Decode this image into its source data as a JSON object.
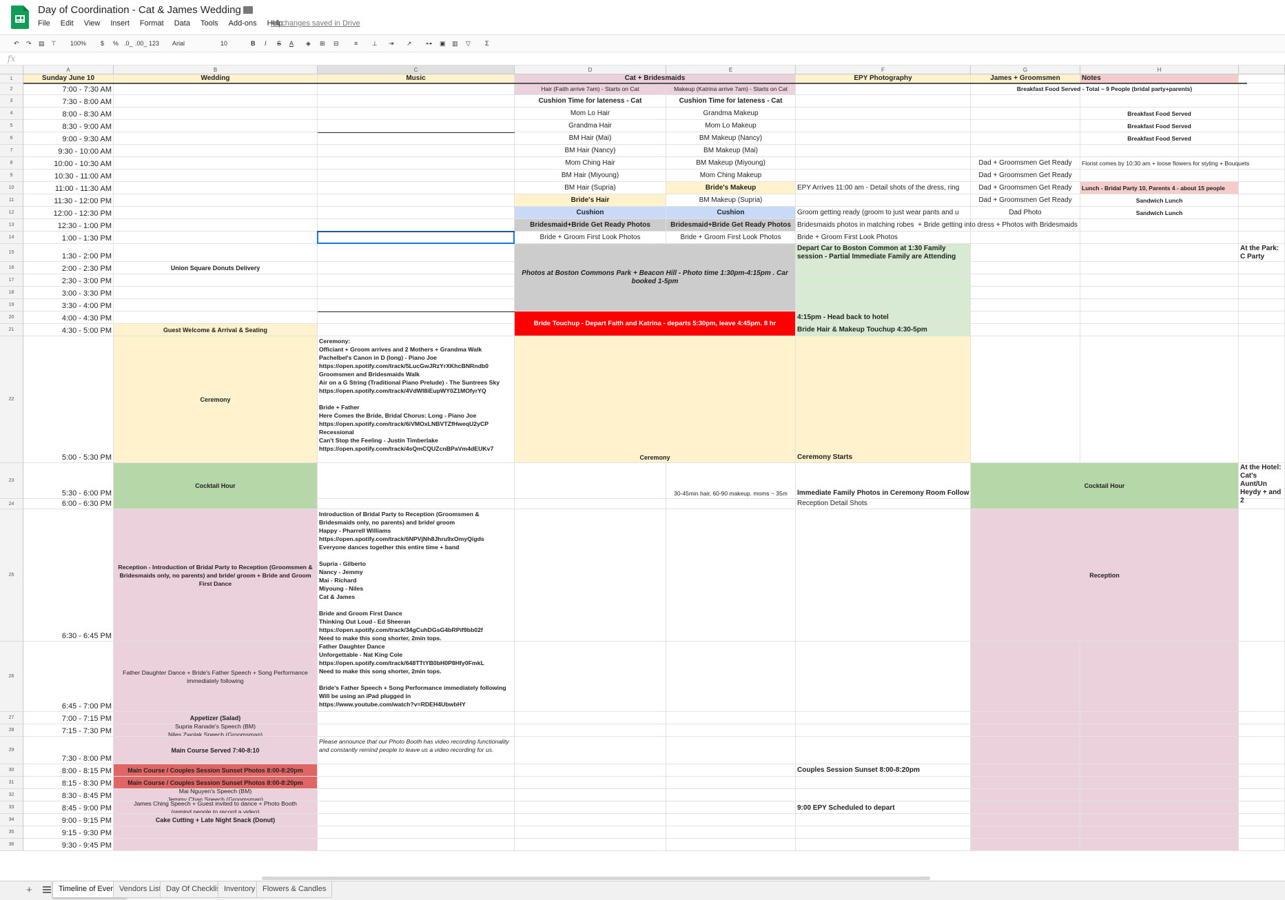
{
  "doc": {
    "title": "Day of Coordination - Cat & James Wedding",
    "saved": "All changes saved in Drive"
  },
  "menu": [
    "File",
    "Edit",
    "View",
    "Insert",
    "Format",
    "Data",
    "Tools",
    "Add-ons",
    "Help"
  ],
  "toolbar": {
    "zoom": "100%",
    "currency": "$",
    "percent": "%",
    "dec_less": ".0_",
    "dec_more": ".00_",
    "format": "123",
    "font": "Arial",
    "size": "10"
  },
  "formula_bar": {
    "fx": "fx",
    "value": ""
  },
  "columns": [
    "A",
    "B",
    "C",
    "D",
    "E",
    "F",
    "G",
    "H"
  ],
  "sheet_tabs": [
    "Timeline of Events",
    "Vendors List",
    "Day Of Checklist",
    "Inventory",
    "Flowers & Candles"
  ],
  "active_tab": "Timeline of Events",
  "colors": {
    "header_yellow": "#fff2cc",
    "pink": "#ead1dc",
    "green": "#d9ead3",
    "green_dark": "#b6d7a8",
    "gray": "#cccccc",
    "blue": "#c9daf8",
    "red": "#ff0000",
    "salmon": "#e06666",
    "light_pink": "#f4cccc",
    "grid": "#e2e2e2",
    "selection": "#1a73e8"
  },
  "row_labels": [
    "1",
    "2",
    "3",
    "4",
    "5",
    "6",
    "7",
    "8",
    "9",
    "10",
    "11",
    "12",
    "13",
    "14",
    "15",
    "16",
    "17",
    "18",
    "19",
    "20",
    "21",
    "22",
    "23",
    "24",
    "25",
    "26",
    "27",
    "28",
    "29",
    "30",
    "31",
    "32",
    "33",
    "34",
    "35",
    "36"
  ],
  "cells": [
    {
      "id": "A1",
      "v": "Sunday June 10"
    },
    {
      "id": "B1",
      "v": "Wedding"
    },
    {
      "id": "C1",
      "v": "Music"
    },
    {
      "id": "D1",
      "v": "Cat + Bridesmaids"
    },
    {
      "id": "F1",
      "v": "EPY Photography"
    },
    {
      "id": "G1",
      "v": "James + Groomsmen"
    },
    {
      "id": "H1",
      "v": "Notes"
    },
    {
      "id": "A2",
      "v": "7:00 - 7:30 AM"
    },
    {
      "id": "A3",
      "v": "7:30 - 8:00 AM"
    },
    {
      "id": "A4",
      "v": "8:00 - 8:30 AM"
    },
    {
      "id": "A5",
      "v": "8:30 - 9:00 AM"
    },
    {
      "id": "A6",
      "v": "9:00 - 9:30 AM"
    },
    {
      "id": "A7",
      "v": "9:30 - 10:00 AM"
    },
    {
      "id": "A8",
      "v": "10:00 - 10:30 AM"
    },
    {
      "id": "A9",
      "v": "10:30 - 11:00 AM"
    },
    {
      "id": "A10",
      "v": "11:00 - 11:30 AM"
    },
    {
      "id": "A11",
      "v": "11:30 - 12:00 PM"
    },
    {
      "id": "A12",
      "v": "12:00 - 12:30 PM"
    },
    {
      "id": "A13",
      "v": "12:30 - 1:00 PM"
    },
    {
      "id": "A14",
      "v": "1:00 - 1:30 PM"
    },
    {
      "id": "A15",
      "v": "1:30 - 2:00 PM"
    },
    {
      "id": "A16",
      "v": "2:00 - 2:30 PM"
    },
    {
      "id": "A17",
      "v": "2:30 - 3:00 PM"
    },
    {
      "id": "A18",
      "v": "3:00 - 3:30 PM"
    },
    {
      "id": "A19",
      "v": "3:30 - 4:00 PM"
    },
    {
      "id": "A20",
      "v": "4:00 - 4:30 PM"
    },
    {
      "id": "A21",
      "v": "4:30 - 5:00 PM"
    },
    {
      "id": "A22",
      "v": "5:00 - 5:30 PM"
    },
    {
      "id": "A23",
      "v": "5:30 - 6:00 PM"
    },
    {
      "id": "A24",
      "v": "6:00 - 6:30 PM"
    },
    {
      "id": "A25",
      "v": "6:30 - 6:45 PM"
    },
    {
      "id": "A26",
      "v": "6:45 - 7:00 PM"
    },
    {
      "id": "A27",
      "v": "7:00 - 7:15 PM"
    },
    {
      "id": "A28",
      "v": "7:15 - 7:30 PM"
    },
    {
      "id": "A29",
      "v": "7:30 - 8:00 PM"
    },
    {
      "id": "A30",
      "v": "8:00 - 8:15 PM"
    },
    {
      "id": "A31",
      "v": "8:15 - 8:30 PM"
    },
    {
      "id": "A32",
      "v": "8:30 - 8:45 PM"
    },
    {
      "id": "A33",
      "v": "8:45 - 9:00 PM"
    },
    {
      "id": "A34",
      "v": "9:00 - 9:15 PM"
    },
    {
      "id": "A35",
      "v": "9:15 - 9:30 PM"
    },
    {
      "id": "A36",
      "v": "9:30 - 9:45 PM"
    },
    {
      "id": "D2",
      "v": "Hair (Faith arrive 7am) - Starts on Cat"
    },
    {
      "id": "E2",
      "v": "Makeup (Katrina arrive 7am) - Starts on Cat"
    },
    {
      "id": "G2",
      "v": "Breakfast Food Served - Total ~ 9 People (bridal party+parents)"
    },
    {
      "id": "D3",
      "v": "Cushion Time for lateness - Cat"
    },
    {
      "id": "E3",
      "v": "Cushion Time for lateness - Cat"
    },
    {
      "id": "D4",
      "v": "Mom Lo Hair"
    },
    {
      "id": "E4",
      "v": "Grandma Makeup"
    },
    {
      "id": "H4",
      "v": "Breakfast Food Served"
    },
    {
      "id": "D5",
      "v": "Grandma Hair"
    },
    {
      "id": "E5",
      "v": "Mom Lo Makeup"
    },
    {
      "id": "H5",
      "v": "Breakfast Food Served"
    },
    {
      "id": "D6",
      "v": "BM Hair (Mai)"
    },
    {
      "id": "E6",
      "v": "BM Makeup (Nancy)"
    },
    {
      "id": "H6",
      "v": "Breakfast Food Served"
    },
    {
      "id": "D7",
      "v": "BM Hair (Nancy)"
    },
    {
      "id": "E7",
      "v": "BM Makeup (Mai)"
    },
    {
      "id": "D8",
      "v": "Mom Ching Hair"
    },
    {
      "id": "E8",
      "v": "BM Makeup (Miyoung)"
    },
    {
      "id": "G8",
      "v": "Dad + Groomsmen Get Ready"
    },
    {
      "id": "H8",
      "v": "Florist comes by 10:30 am + loose flowers for styling + Bouquets"
    },
    {
      "id": "D9",
      "v": "BM Hair (Miyoung)"
    },
    {
      "id": "E9",
      "v": "Mom Ching Makeup"
    },
    {
      "id": "G9",
      "v": "Dad + Groomsmen Get Ready"
    },
    {
      "id": "D10",
      "v": "BM Hair (Supria)"
    },
    {
      "id": "E10",
      "v": "Bride's Makeup"
    },
    {
      "id": "F10",
      "v": "EPY Arrives 11:00 am - Detail shots of the dress, ring"
    },
    {
      "id": "G10",
      "v": "Dad + Groomsmen Get Ready"
    },
    {
      "id": "H10",
      "v": "Lunch - Bridal Party 10, Parents 4 - about 15 people"
    },
    {
      "id": "D11",
      "v": "Bride's Hair"
    },
    {
      "id": "E11",
      "v": "BM Makeup (Supria)"
    },
    {
      "id": "G11",
      "v": "Dad + Groomsmen Get Ready"
    },
    {
      "id": "H11",
      "v": "Sandwich Lunch"
    },
    {
      "id": "D12",
      "v": "Cushion"
    },
    {
      "id": "E12",
      "v": "Cushion"
    },
    {
      "id": "F12",
      "v": "Groom getting ready (groom to just wear pants and u"
    },
    {
      "id": "G12",
      "v": "Dad Photo"
    },
    {
      "id": "H12",
      "v": "Sandwich Lunch"
    },
    {
      "id": "D13",
      "v": "Bridesmaid+Bride Get Ready Photos"
    },
    {
      "id": "E13",
      "v": "Bridesmaid+Bride Get Ready Photos"
    },
    {
      "id": "F13",
      "v": "Bridesmaids photos in matching robes  + Bride getting into dress + Photos with Bridesmaids"
    },
    {
      "id": "D14",
      "v": "Bride + Groom First Look Photos"
    },
    {
      "id": "E14",
      "v": "Bride + Groom First Look Photos"
    },
    {
      "id": "F14",
      "v": "Bride + Groom First Look Photos"
    },
    {
      "id": "F15",
      "v": "Depart Car to Boston Common at 1:30 Family session - Partial Immediate Family are Attending"
    },
    {
      "id": "I15",
      "v": "At the Park: C Party"
    },
    {
      "id": "D15",
      "v": "Photos at Boston Commons Park + Beacon Hill - Photo time 1:30pm-4:15pm .  Car booked 1-5pm"
    },
    {
      "id": "B16",
      "v": "Union Square Donuts Delivery"
    },
    {
      "id": "D20",
      "v": "Bride Touchup - Depart Faith and Katrina - departs 5:30pm, leave 4:45pm. 8 hr"
    },
    {
      "id": "F20",
      "v": "4:15pm - Head back to hotel"
    },
    {
      "id": "B21",
      "v": "Guest Welcome & Arrival & Seating"
    },
    {
      "id": "F21",
      "v": "Bride Hair & Makeup Touchup 4:30-5pm"
    },
    {
      "id": "B22",
      "v": "Ceremony"
    },
    {
      "id": "D22",
      "v": "Ceremony"
    },
    {
      "id": "F22",
      "v": "Ceremony Starts"
    },
    {
      "id": "C22",
      "v": "Ceremony:\nOfficiant + Groom arrives and 2 Mothers + Grandma Walk\nPachelbel's Canon in D (long) - Piano Joe\nhttps://open.spotify.com/track/5LucGwJRzYrXKhcBNRndb0\nGroomsmen and Bridesmaids Walk\nAir on a G String (Traditional Piano Prelude) - The Suntrees Sky\nhttps://open.spotify.com/track/4VdWl8iEupWY0Z1MOfyrYQ\n\nBride + Father\nHere Comes the Bride, Bridal Chorus: Long - Piano Joe\nhttps://open.spotify.com/track/6iVMOxLNBVTZfHweqU2yCP\nRecessional\nCan't Stop the Feeling - Justin Timberlake\nhttps://open.spotify.com/track/4sQmCQUZcnBPaVm4dEUKv7"
    },
    {
      "id": "B23",
      "v": "Cocktail Hour"
    },
    {
      "id": "G23",
      "v": "Cocktail Hour"
    },
    {
      "id": "I23",
      "v": "At the Hotel: Cat's Aunt/Un Heydy + and 2"
    },
    {
      "id": "E24",
      "v": "30-45min hair, 60-90 makeup. moms ~ 35m"
    },
    {
      "id": "F24a",
      "v": "Immediate Family Photos in Ceremony Room Follow"
    },
    {
      "id": "F24",
      "v": "Reception Detail Shots"
    },
    {
      "id": "B25",
      "v": "Reception - Introduction of Bridal Party to Reception (Groomsmen & Bridesmaids only, no parents) and bride/ groom + Bride and Groom First Dance"
    },
    {
      "id": "G25",
      "v": "Reception"
    },
    {
      "id": "C25",
      "v": "Introduction of Bridal Party to Reception (Groomsmen & Bridesmaids only, no parents) and bride/ groom\nHappy - Pharrell Williams\nhttps://open.spotify.com/track/6NPVjNh8Jhru9xOmyQigds\nEveryone dances together this entire time + band\n\nSupria - Gilberto\nNancy - Jemmy\nMai - Richard\nMiyoung - Niles\nCat & James\n\nBride and Groom First Dance\nThinking Out Loud - Ed Sheeran\nhttps://open.spotify.com/track/34gCuhDGsG4bRPif9bb02f\nNeed to make this song shorter, 2min tops."
    },
    {
      "id": "B26",
      "v": "Father Daughter Dance + Bride's Father Speech + Song Performance immediately following"
    },
    {
      "id": "C26",
      "v": "Father Daughter Dance\nUnforgettable - Nat King Cole\nhttps://open.spotify.com/track/648TTtYB0bH0P8Hfy0FmkL\nNeed to make this song shorter, 2min tops.\n\nBride's Father Speech + Song Performance immediately following\nWill be using an iPad plugged in\nhttps://www.youtube.com/watch?v=RDEH4UbwbHY"
    },
    {
      "id": "B27",
      "v": "Appetizer (Salad)"
    },
    {
      "id": "B28",
      "v": "Supria Ranade's Speech (BM)\nNiles Zwolak Speech (Groomsman)"
    },
    {
      "id": "B29",
      "v": "Main Course Served 7:40-8:10"
    },
    {
      "id": "C29",
      "v": "Please announce that our Photo Booth has video recording functionality and constantly remind people to leave us a video recording for us."
    },
    {
      "id": "B30",
      "v": "Main Course / Couples Session Sunset Photos 8:00-8:20pm"
    },
    {
      "id": "F30",
      "v": "Couples Session Sunset 8:00-8:20pm"
    },
    {
      "id": "B31",
      "v": "Main Course / Couples Session Sunset Photos 8:00-8:20pm"
    },
    {
      "id": "B32",
      "v": "Mai Nguyen's Speech (BM)\nJemmy Chan Speech (Groomsman)"
    },
    {
      "id": "B33",
      "v": "James Ching Speech + Guest invited to dance + Photo Booth\n(remind people to record a video)"
    },
    {
      "id": "F33",
      "v": "9:00 EPY Scheduled to depart"
    },
    {
      "id": "B34",
      "v": "Cake Cutting + Late Night Snack (Donut)"
    }
  ]
}
